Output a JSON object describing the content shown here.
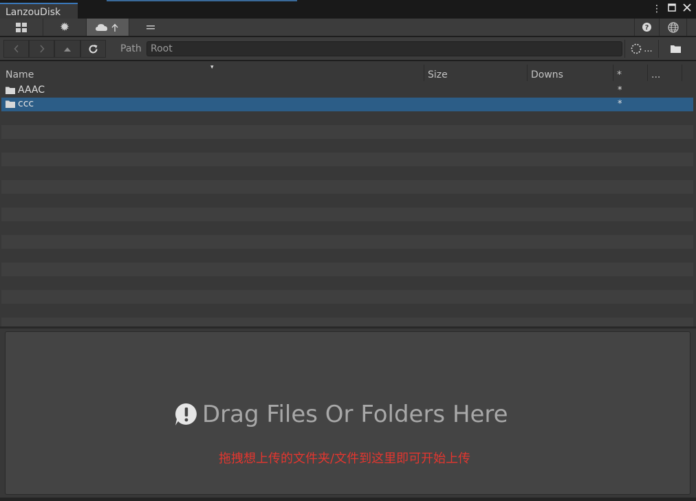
{
  "window": {
    "tab_title": "LanzouDisk",
    "menu_icon": "kebab-menu-icon",
    "maximize_icon": "maximize-icon",
    "close_icon": "close-icon"
  },
  "toolbar": {
    "grid_icon": "grid-icon",
    "settings_icon": "gear-icon",
    "upload_icon": "cloud-upload-icon",
    "menu_icon": "hamburger-icon",
    "help_icon": "help-icon",
    "language_icon": "globe-icon"
  },
  "pathbar": {
    "back_icon": "chevron-left-icon",
    "forward_icon": "chevron-right-icon",
    "up_icon": "up-arrow-icon",
    "refresh_icon": "refresh-icon",
    "label": "Path",
    "value": "Root",
    "loading_icon": "dotted-circle-icon",
    "loading_label": "...",
    "folder_icon": "folder-icon"
  },
  "table": {
    "columns": [
      "Name",
      "Size",
      "Downs",
      "*",
      "..."
    ],
    "sort_indicator": "▾",
    "rows": [
      {
        "name": "AAAC",
        "size": "",
        "downs": "",
        "star": "*",
        "selected": false
      },
      {
        "name": "ccc",
        "size": "",
        "downs": "",
        "star": "*",
        "selected": true
      }
    ]
  },
  "dropzone": {
    "title": "Drag Files Or Folders Here",
    "subtitle": "拖拽想上传的文件夹/文件到这里即可开始上传",
    "icon": "exclamation-bubble-icon"
  },
  "colors": {
    "accent": "#2c5d87",
    "warning_text": "#e4362f"
  }
}
